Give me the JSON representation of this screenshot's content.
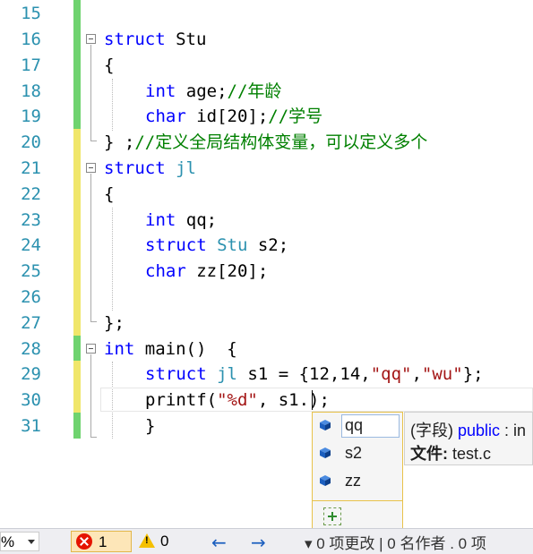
{
  "editor": {
    "line_numbers": [
      "15",
      "16",
      "17",
      "18",
      "19",
      "20",
      "21",
      "22",
      "23",
      "24",
      "25",
      "26",
      "27",
      "28",
      "29",
      "30",
      "31"
    ],
    "lines": {
      "l16": {
        "kw": "struct",
        "rest": " Stu"
      },
      "l17": {
        "text": "{"
      },
      "l18": {
        "kw": "int",
        "rest": " age;",
        "comment": "//年龄"
      },
      "l19": {
        "kw": "char",
        "rest": " id[20];",
        "comment": "//学号"
      },
      "l20": {
        "text": "} ;",
        "comment": "//定义全局结构体变量，可以定义多个"
      },
      "l21": {
        "kw": "struct",
        "type": "jl"
      },
      "l22": {
        "text": "{"
      },
      "l23": {
        "kw": "int",
        "rest": " qq;"
      },
      "l24": {
        "kw": "struct",
        "type": "Stu",
        "rest": " s2;"
      },
      "l25": {
        "kw": "char",
        "rest": " zz[20];"
      },
      "l27": {
        "text": "};"
      },
      "l28": {
        "kw": "int",
        "rest": " main()  {"
      },
      "l29": {
        "kw": "struct",
        "type": "jl",
        "rest1": " s1 = {12,14,",
        "s1": "\"qq\"",
        "comma": ",",
        "s2": "\"wu\"",
        "rest2": "};"
      },
      "l30": {
        "text1": "printf(",
        "s1": "\"%d\"",
        "text2": ", s1.",
        "text3": ");"
      },
      "l31": {
        "text": "}"
      }
    }
  },
  "completion": {
    "items": [
      {
        "label": "qq",
        "icon": "field-icon",
        "selected": true
      },
      {
        "label": "s2",
        "icon": "field-icon",
        "selected": false
      },
      {
        "label": "zz",
        "icon": "field-icon",
        "selected": false
      }
    ]
  },
  "tooltip": {
    "line1_prefix": "(字段) ",
    "line1_keyword": "public",
    "line1_suffix": " : in",
    "line2_label": "文件:",
    "line2_value": " test.c"
  },
  "statusbar": {
    "zoom": "%",
    "errors": "1",
    "warnings": "0",
    "back_arrow": "←",
    "forward_arrow": "→",
    "text": "▾ 0  项更改 | 0  名作者 . 0  项"
  },
  "colors": {
    "keyword": "#0000ff",
    "type": "#2b91af",
    "comment": "#008000",
    "string": "#a31515",
    "changed_saved": "#6fd36f",
    "changed_unsaved": "#f0e66a",
    "error": "#e51400",
    "warning": "#f5c000"
  }
}
